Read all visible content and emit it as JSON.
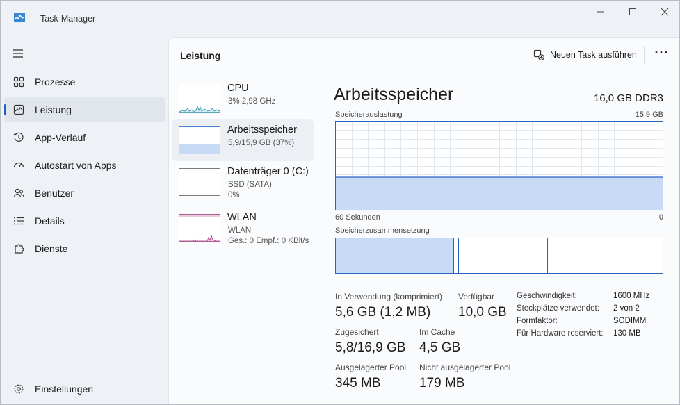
{
  "window": {
    "title": "Task-Manager"
  },
  "sidebar": {
    "items": [
      {
        "label": "Prozesse",
        "icon": "grid-icon"
      },
      {
        "label": "Leistung",
        "icon": "performance-icon"
      },
      {
        "label": "App-Verlauf",
        "icon": "history-icon"
      },
      {
        "label": "Autostart von Apps",
        "icon": "speedometer-icon"
      },
      {
        "label": "Benutzer",
        "icon": "users-icon"
      },
      {
        "label": "Details",
        "icon": "list-icon"
      },
      {
        "label": "Dienste",
        "icon": "puzzle-icon"
      }
    ],
    "settings_label": "Einstellungen",
    "active_index": 1
  },
  "header": {
    "title": "Leistung",
    "new_task_label": "Neuen Task ausführen"
  },
  "resources": [
    {
      "name": "CPU",
      "sub1": "3%  2,98 GHz",
      "sub2": ""
    },
    {
      "name": "Arbeitsspeicher",
      "sub1": "5,9/15,9 GB (37%)",
      "sub2": ""
    },
    {
      "name": "Datenträger 0 (C:)",
      "sub1": "SSD (SATA)",
      "sub2": "0%"
    },
    {
      "name": "WLAN",
      "sub1": "WLAN",
      "sub2": "Ges.: 0 Empf.: 0 KBit/s"
    }
  ],
  "detail": {
    "title": "Arbeitsspeicher",
    "spec": "16,0 GB DDR3",
    "usage_label": "Speicherauslastung",
    "usage_max": "15,9 GB",
    "time_label": "60 Sekunden",
    "time_end": "0",
    "composition_label": "Speicherzusammensetzung",
    "usage_fraction": 0.37,
    "stats": [
      {
        "label": "In Verwendung (komprimiert)",
        "value": "5,6 GB (1,2 MB)"
      },
      {
        "label": "Verfügbar",
        "value": "10,0 GB"
      },
      {
        "label": "Zugesichert",
        "value": "5,8/16,9 GB"
      },
      {
        "label": "Im Cache",
        "value": "4,5 GB"
      },
      {
        "label": "Ausgelagerter Pool",
        "value": "345 MB"
      },
      {
        "label": "Nicht ausgelagerter Pool",
        "value": "179 MB"
      }
    ],
    "props": [
      {
        "label": "Geschwindigkeit:",
        "value": "1600 MHz"
      },
      {
        "label": "Steckplätze verwendet:",
        "value": "2 von 2"
      },
      {
        "label": "Formfaktor:",
        "value": "SODIMM"
      },
      {
        "label": "Für Hardware reserviert:",
        "value": "130 MB"
      }
    ]
  },
  "colors": {
    "accent": "#1f5fbf",
    "memory_fill": "#c7dbf6",
    "memory_line": "#2a62c6",
    "cpu_line": "#1b8fa8",
    "wlan_line": "#a3307a"
  }
}
